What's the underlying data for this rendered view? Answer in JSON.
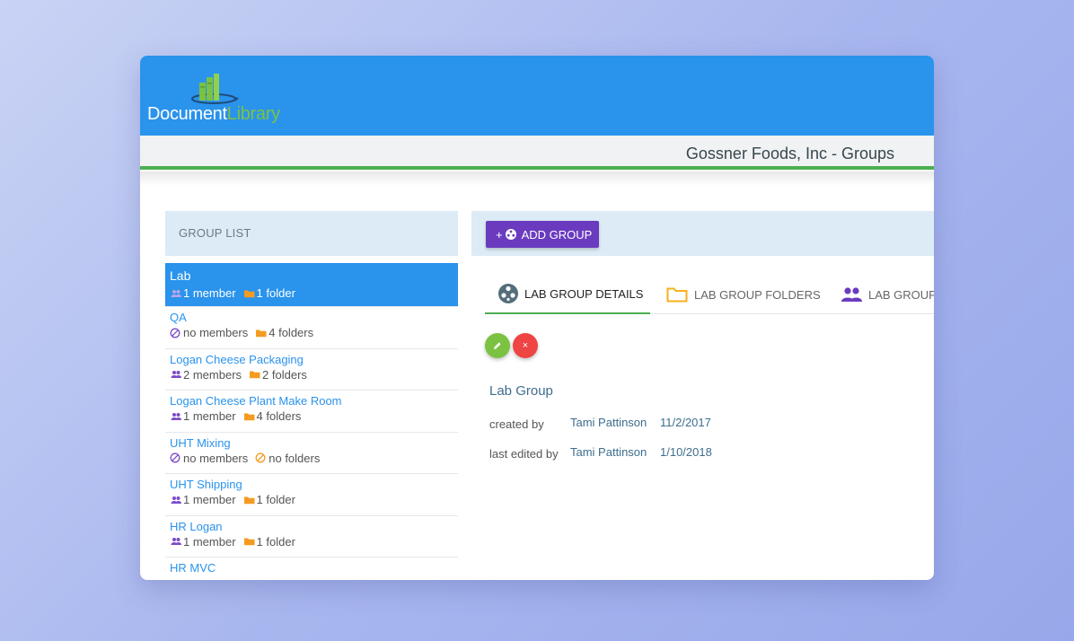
{
  "logo": {
    "word1": "Document",
    "word2": "Library"
  },
  "page_title": "Gossner Foods, Inc - Groups",
  "group_list": {
    "header": "GROUP LIST",
    "items": [
      {
        "name": "Lab",
        "members": "1 member",
        "folders": "1 folder",
        "members_icon": "people-icon",
        "folders_icon": "folder-icon"
      },
      {
        "name": "QA",
        "members": "no members",
        "folders": "4 folders",
        "members_icon": "no-entry-icon",
        "folders_icon": "folder-icon"
      },
      {
        "name": "Logan Cheese Packaging",
        "members": "2 members",
        "folders": "2 folders",
        "members_icon": "people-icon",
        "folders_icon": "folder-icon"
      },
      {
        "name": "Logan Cheese Plant Make Room",
        "members": "1 member",
        "folders": "4 folders",
        "members_icon": "people-icon",
        "folders_icon": "folder-icon"
      },
      {
        "name": "UHT Mixing",
        "members": "no members",
        "folders": "no folders",
        "members_icon": "no-entry-icon",
        "folders_icon": "no-entry-icon"
      },
      {
        "name": "UHT Shipping",
        "members": "1 member",
        "folders": "1 folder",
        "members_icon": "people-icon",
        "folders_icon": "folder-icon"
      },
      {
        "name": "HR Logan",
        "members": "1 member",
        "folders": "1 folder",
        "members_icon": "people-icon",
        "folders_icon": "folder-icon"
      },
      {
        "name": "HR MVC",
        "members": "",
        "folders": "",
        "members_icon": "",
        "folders_icon": ""
      }
    ]
  },
  "toolbar": {
    "add_group_plus": "+",
    "add_group_label": "ADD GROUP"
  },
  "tabs": [
    {
      "label": "LAB GROUP DETAILS",
      "icon": "film-reel-icon",
      "active": true
    },
    {
      "label": "LAB GROUP FOLDERS",
      "icon": "folder-outline-icon",
      "active": false
    },
    {
      "label": "LAB GROUP",
      "icon": "people-icon",
      "active": false
    }
  ],
  "details": {
    "title": "Lab Group",
    "created_label": "created by",
    "created_user": "Tami Pattinson",
    "created_date": "11/2/2017",
    "edited_label": "last edited by",
    "edited_user": "Tami Pattinson",
    "edited_date": "1/10/2018",
    "edit_icon": "pencil-icon",
    "delete_icon": "close-icon",
    "delete_glyph": "×"
  },
  "colors": {
    "topbar": "#2a93ec",
    "accent_green": "#4caf50",
    "purple": "#6a3bbf",
    "orange": "#f59b21",
    "delete_red": "#ef4444"
  }
}
